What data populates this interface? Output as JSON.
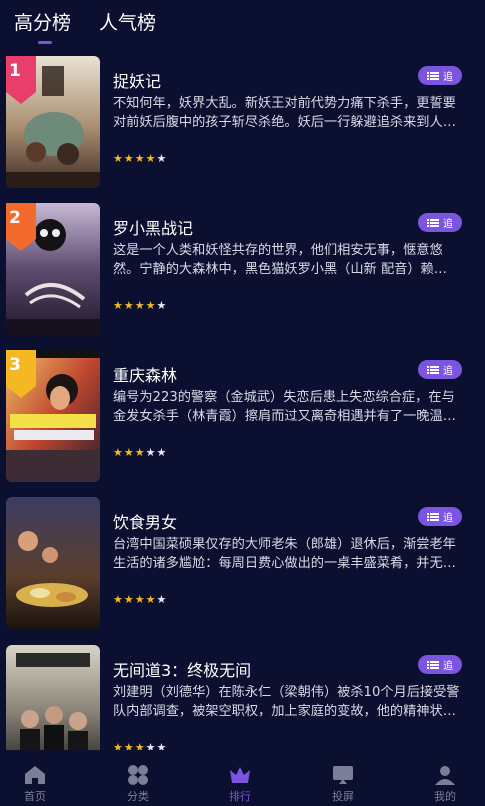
{
  "tabs": [
    {
      "label": "高分榜",
      "active": true
    },
    {
      "label": "人气榜",
      "active": false
    }
  ],
  "accent_color": "#7b55e0",
  "items": [
    {
      "rank": "1",
      "rank_color": "#e83e6b",
      "title": "捉妖记",
      "desc": "不知何年，妖界大乱。新妖王对前代势力痛下杀手，更誓要对前妖后腹中的孩子斩尽杀绝。妖后一行躲避追杀来到人间……",
      "rating": 4,
      "rating_max": 5,
      "follow_label": "追"
    },
    {
      "rank": "2",
      "rank_color": "#f26a2c",
      "title": "罗小黑战记",
      "desc": "这是一个人类和妖怪共存的世界，他们相安无事，惬意悠然。宁静的大森林中，黑色猫妖罗小黑（山新 配音）赖以生存的家园……",
      "rating": 4,
      "rating_max": 5,
      "follow_label": "追"
    },
    {
      "rank": "3",
      "rank_color": "#f5b823",
      "title": "重庆森林",
      "desc": "编号为223的警察（金城武）失恋后患上失恋综合症，在与金发女杀手（林青霞）擦肩而过又离奇相遇并有了一晚温情之后……",
      "rating": 3,
      "rating_max": 5,
      "follow_label": "追"
    },
    {
      "rank": "",
      "rank_color": "",
      "title": "饮食男女",
      "desc": "台湾中国菜硕果仅存的大师老朱（郎雄）退休后，渐尝老年生活的诸多尴尬：每周日费心做出的一桌丰盛菜肴，并无人欣赏……",
      "rating": 4,
      "rating_max": 5,
      "follow_label": "追"
    },
    {
      "rank": "",
      "rank_color": "",
      "title": "无间道3：终极无间",
      "desc": "刘建明（刘德华）在陈永仁（梁朝伟）被杀10个月后接受警队内部调查，被架空职权，加上家庭的变故，他的精神状态……",
      "rating": 3,
      "rating_max": 5,
      "follow_label": "追"
    }
  ],
  "bottom_nav": [
    {
      "label": "首页",
      "icon": "home-icon",
      "active": false
    },
    {
      "label": "分类",
      "icon": "category-icon",
      "active": false
    },
    {
      "label": "排行",
      "icon": "ranking-crown-icon",
      "active": true
    },
    {
      "label": "投屏",
      "icon": "cast-screen-icon",
      "active": false
    },
    {
      "label": "我的",
      "icon": "profile-icon",
      "active": false
    }
  ]
}
